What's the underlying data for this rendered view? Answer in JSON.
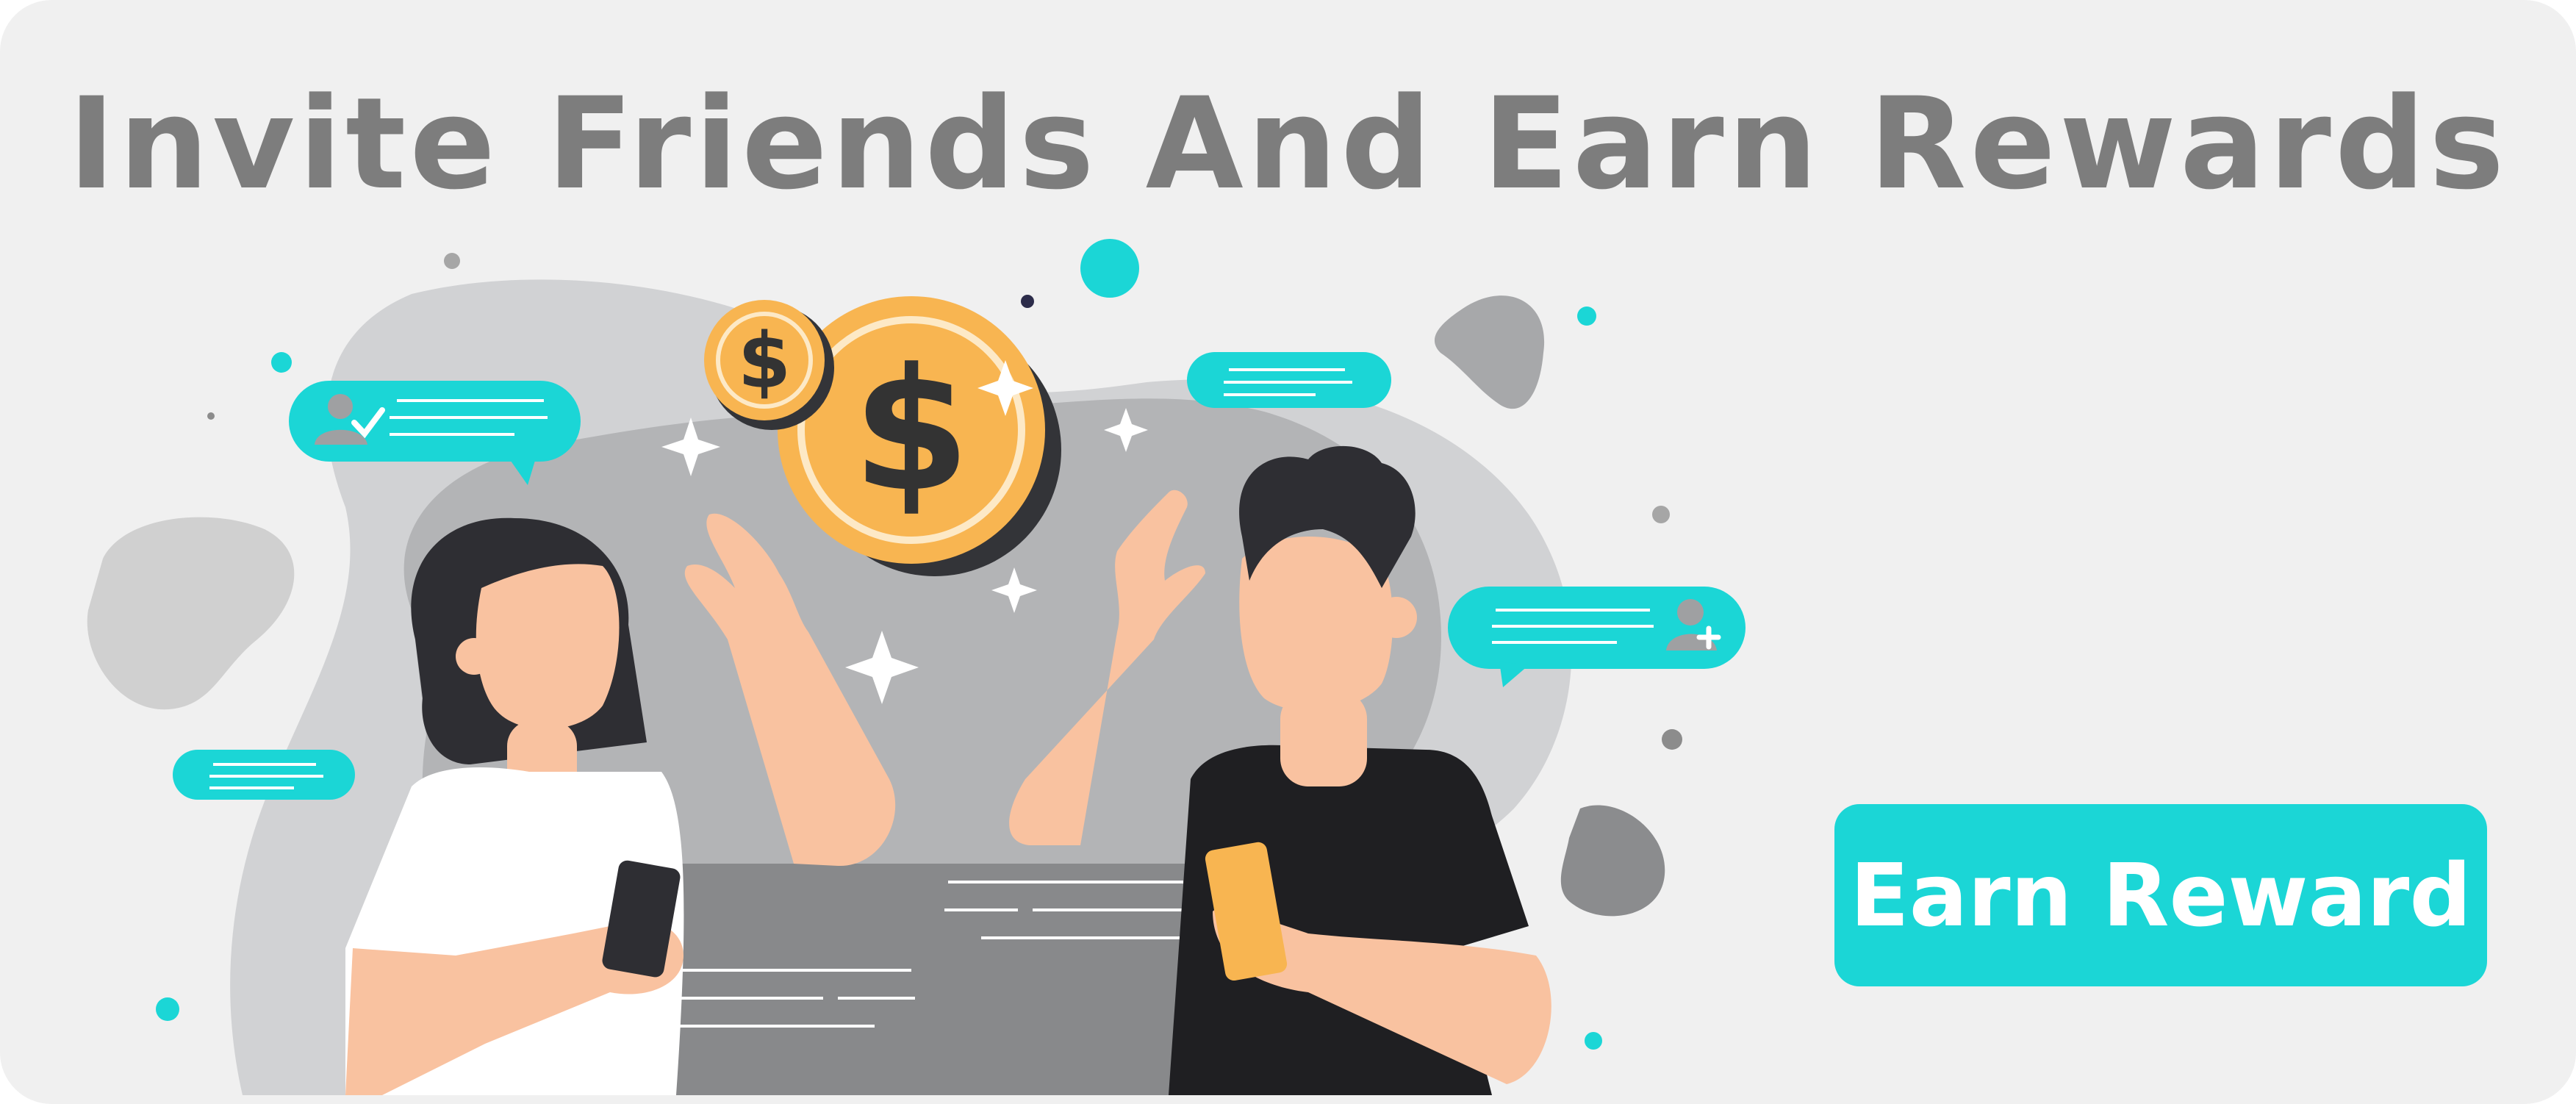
{
  "banner": {
    "headline": "Invite Friends And Earn Rewards",
    "cta_label": "Earn Reward"
  },
  "colors": {
    "background": "#f0f0f0",
    "headline_text": "#7d7d7d",
    "accent": "#1bd6d6",
    "coin": "#f8b551",
    "coin_symbol": "#333333",
    "skin": "#f9c2a0",
    "hair": "#2e2e33",
    "shirt_dark": "#1f1f22",
    "shirt_light": "#ffffff",
    "blob_gray": "#8a8a8a"
  },
  "icons": {
    "coin": "dollar-coin-icon",
    "sparkle": "sparkle-icon",
    "user_check": "user-check-icon",
    "user_add": "user-add-icon"
  },
  "coin_symbol": "$"
}
